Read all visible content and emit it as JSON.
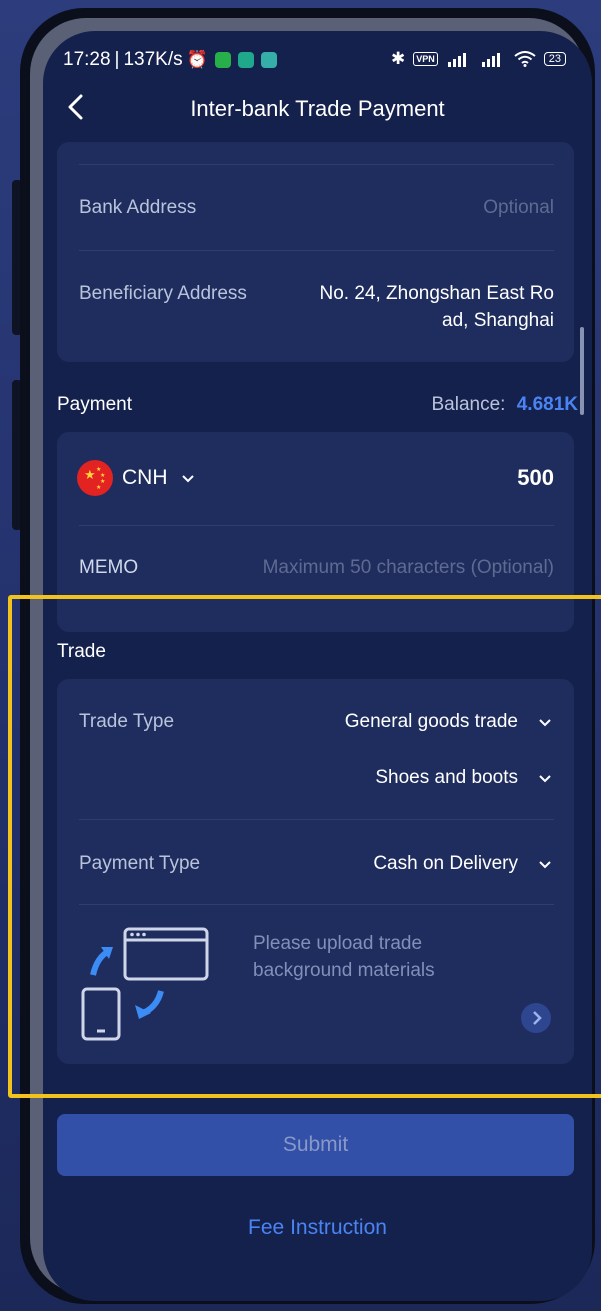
{
  "status_bar": {
    "time": "17:28",
    "network_speed": "137K/s",
    "vpn": "VPN",
    "battery": "23"
  },
  "header": {
    "title": "Inter-bank Trade Payment"
  },
  "beneficiary": {
    "bank_address_label": "Bank Address",
    "bank_address_placeholder": "Optional",
    "beneficiary_address_label": "Beneficiary Address",
    "beneficiary_address_line1": "No. 24, Zhongshan East Ro",
    "beneficiary_address_line2": "ad, Shanghai"
  },
  "payment": {
    "section_label": "Payment",
    "balance_label": "Balance:",
    "balance_value": "4.681K",
    "currency": "CNH",
    "amount": "500",
    "memo_label": "MEMO",
    "memo_placeholder": "Maximum 50 characters (Optional)"
  },
  "trade": {
    "section_label": "Trade",
    "trade_type_label": "Trade Type",
    "trade_type_value": "General goods trade",
    "trade_subtype_value": "Shoes and boots",
    "payment_type_label": "Payment Type",
    "payment_type_value": "Cash on Delivery",
    "upload_line1": "Please upload trade",
    "upload_line2": "background materials"
  },
  "actions": {
    "submit_label": "Submit",
    "fee_instruction_label": "Fee Instruction"
  },
  "colors": {
    "accent": "#4a84f2",
    "highlight": "#f2c21d",
    "background": "#15214d",
    "card": "#1f2d5e"
  }
}
